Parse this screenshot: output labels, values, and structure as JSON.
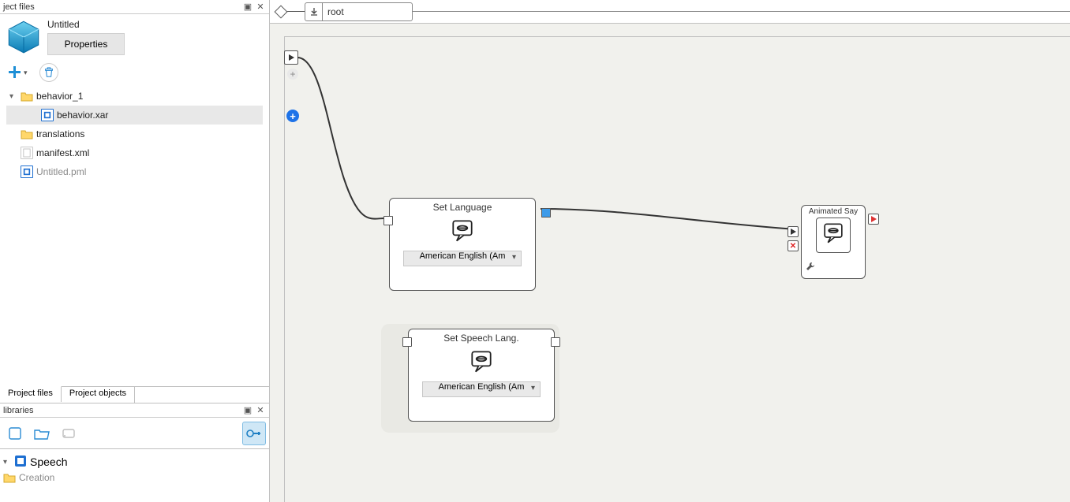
{
  "panels": {
    "project_files": {
      "header": "ject files",
      "project_title": "Untitled",
      "properties_btn": "Properties",
      "tree": {
        "behavior_folder": "behavior_1",
        "behavior_file": "behavior.xar",
        "translations_folder": "translations",
        "manifest_file": "manifest.xml",
        "pml_file": "Untitled.pml"
      },
      "tabs": {
        "files": "Project files",
        "objects": "Project objects"
      }
    },
    "libraries": {
      "header": "libraries",
      "tree": {
        "speech": "Speech",
        "creation": "Creation"
      }
    }
  },
  "breadcrumb": {
    "root": "root"
  },
  "nodes": {
    "set_language": {
      "title": "Set Language",
      "dropdown": "American English (Am"
    },
    "set_speech_lang": {
      "title": "Set Speech Lang.",
      "dropdown": "American English (Am"
    },
    "animated_say": {
      "title": "Animated Say"
    }
  }
}
